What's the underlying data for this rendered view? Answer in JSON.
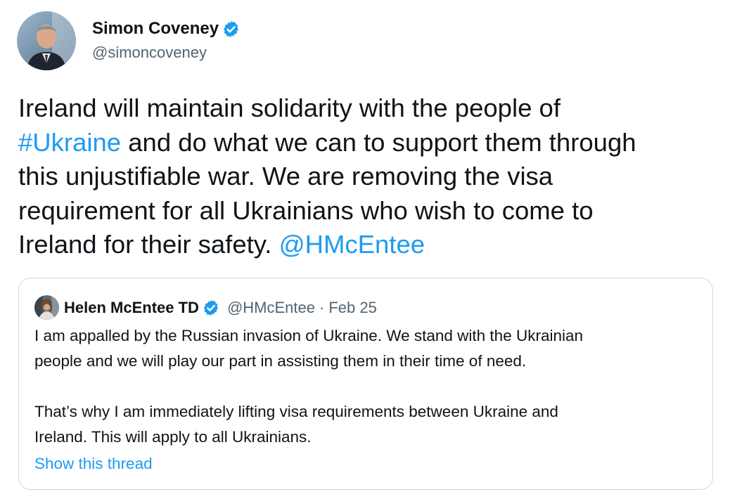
{
  "author": {
    "name": "Simon Coveney",
    "handle": "@simoncoveney",
    "verified": true,
    "avatar": "profile-photo"
  },
  "tweet": {
    "line1": "Ireland will maintain solidarity with the people of",
    "hashtag": "#Ukraine",
    "line2_rest": " and do what we can to support them through",
    "line3": "this unjustifiable war. We are removing the visa",
    "line4": "requirement for all Ukrainians who wish to come to",
    "line5_start": "Ireland for their safety. ",
    "mention": "@HMcEntee"
  },
  "quoted_tweet": {
    "name": "Helen McEntee TD",
    "handle": "@HMcEntee",
    "separator": "·",
    "date": "Feb 25",
    "verified": true,
    "paragraph1_line1": "I am appalled by the Russian invasion of Ukraine. We stand with the Ukrainian",
    "paragraph1_line2": "people and we will play our part in assisting them in their time of need.",
    "paragraph2_line1": "That’s why I am immediately lifting visa requirements between Ukraine and",
    "paragraph2_line2": "Ireland. This will apply to all Ukrainians.",
    "show_thread": "Show this thread"
  },
  "colors": {
    "link": "#1d9bf0",
    "text": "#0f1419",
    "secondary": "#536471",
    "border": "#cfd9de",
    "verified_badge": "#1d9bf0"
  },
  "icons": {
    "verified": "verified-badge-icon"
  }
}
